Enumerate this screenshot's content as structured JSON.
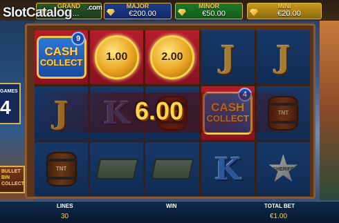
{
  "logo": {
    "brand": "Slot",
    "brand2": "Catalog",
    "tld": ".com"
  },
  "jackpots": {
    "grand": {
      "label": "GRAND",
      "value": "€..."
    },
    "major": {
      "label": "MAJOR",
      "value": "€200.00"
    },
    "minor": {
      "label": "MINOR",
      "value": "€50.00"
    },
    "mini": {
      "label": "MINI",
      "value": "€20.00"
    }
  },
  "free_spins": {
    "label": "GAMES",
    "value": "4"
  },
  "side_logo": {
    "lines": [
      "BULLET",
      "BIN",
      "COLLECT"
    ]
  },
  "reels": [
    [
      "cash_collect",
      "J",
      "barrel"
    ],
    [
      "coin",
      "K",
      "box"
    ],
    [
      "coin",
      "barrel",
      "box"
    ],
    [
      "J",
      "cash_collect",
      "K"
    ],
    [
      "J",
      "barrel",
      "sheriff"
    ]
  ],
  "coins": {
    "reel2": "1.00",
    "reel3": "2.00"
  },
  "cash_collect": {
    "text_top": "CASH",
    "text_bottom": "COLLECT",
    "badge1": "9",
    "badge2": "4"
  },
  "symbols": {
    "J": "J",
    "K": "K",
    "tnt": "TNT",
    "sheriff": "SHERIFF"
  },
  "win_amount": "6.00",
  "bottom_bar": {
    "lines_label": "LINES",
    "lines_value": "30",
    "win_label": "WIN",
    "win_value": "",
    "bet_label": "TOTAL BET",
    "bet_value": "€1.00"
  },
  "colors": {
    "gold": "#ffd34a",
    "reel_bg": "#1e4a8a",
    "frame": "#5a3218"
  }
}
